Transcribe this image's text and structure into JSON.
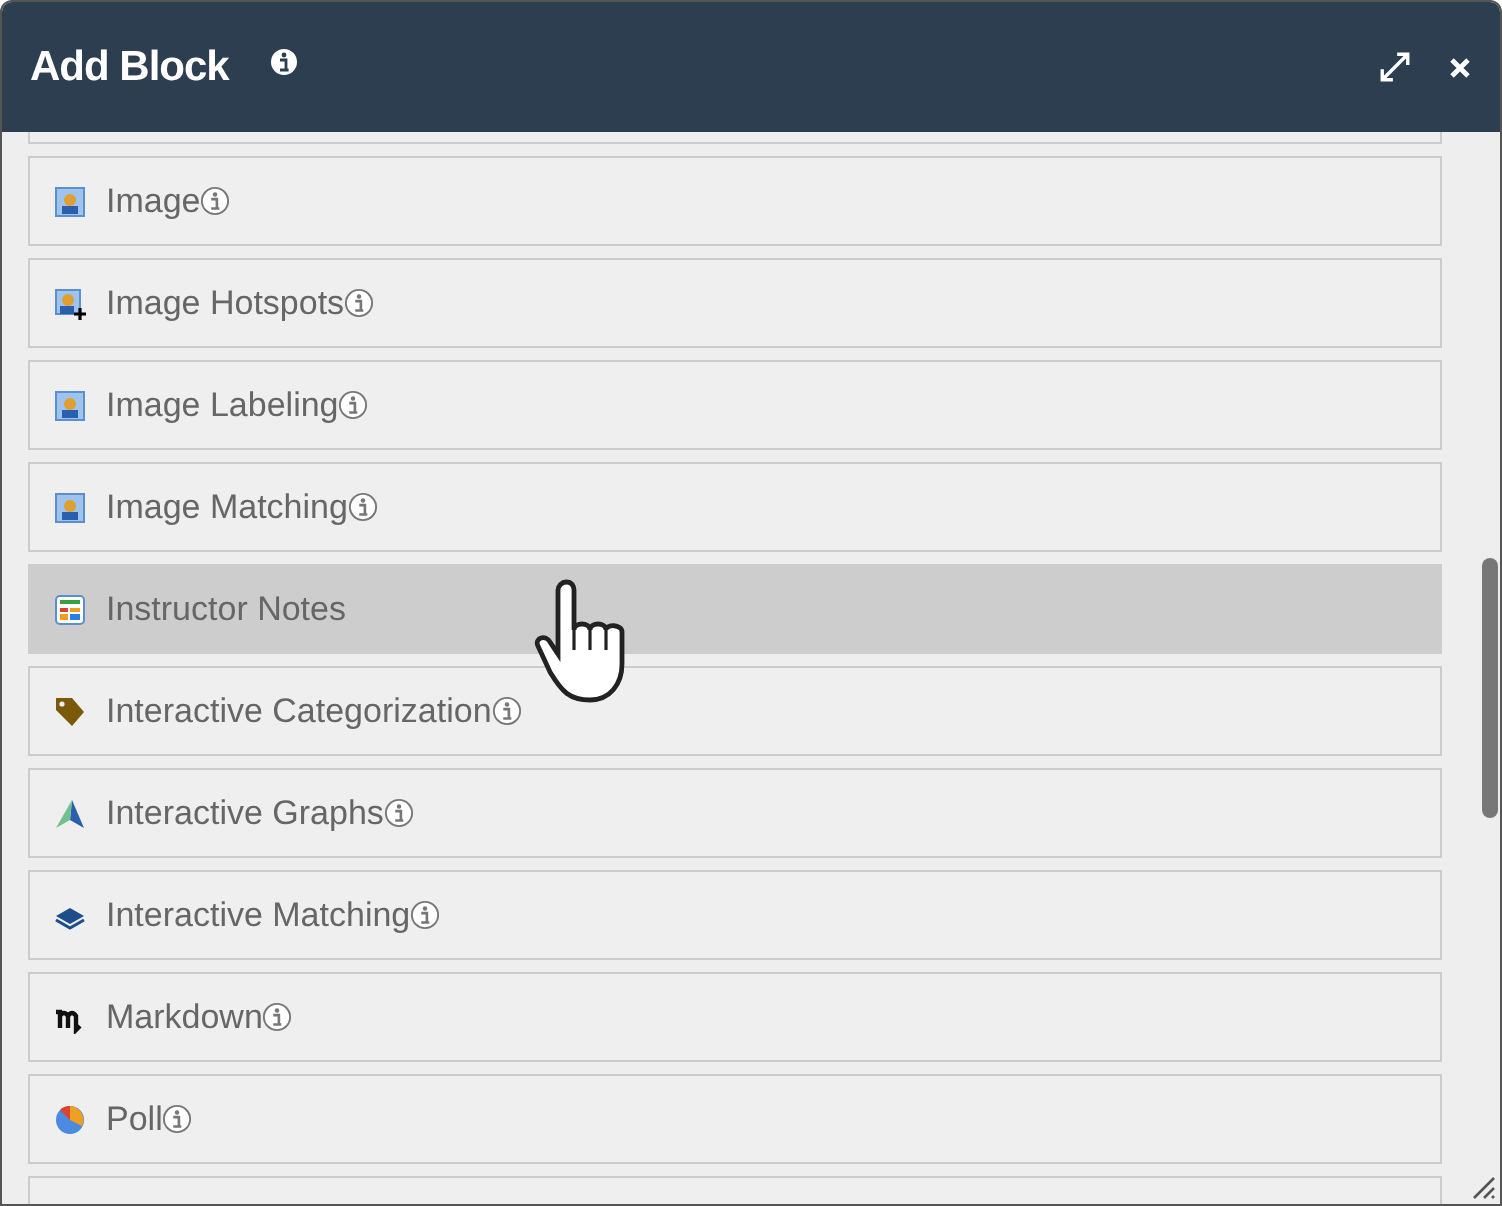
{
  "window": {
    "title": "Add Block"
  },
  "items": [
    {
      "label": "Image",
      "kind": "image",
      "info": true,
      "selected": false
    },
    {
      "label": "Image Hotspots",
      "kind": "image-plus",
      "info": true,
      "selected": false
    },
    {
      "label": "Image Labeling",
      "kind": "image",
      "info": true,
      "selected": false
    },
    {
      "label": "Image Matching",
      "kind": "image",
      "info": true,
      "selected": false
    },
    {
      "label": "Instructor Notes",
      "kind": "notes",
      "info": false,
      "selected": true
    },
    {
      "label": "Interactive Categorization",
      "kind": "tag",
      "info": true,
      "selected": false
    },
    {
      "label": "Interactive Graphs",
      "kind": "graph",
      "info": true,
      "selected": false
    },
    {
      "label": "Interactive Matching",
      "kind": "layers",
      "info": true,
      "selected": false
    },
    {
      "label": "Markdown",
      "kind": "markdown",
      "info": true,
      "selected": false
    },
    {
      "label": "Poll",
      "kind": "pie",
      "info": true,
      "selected": false
    }
  ]
}
